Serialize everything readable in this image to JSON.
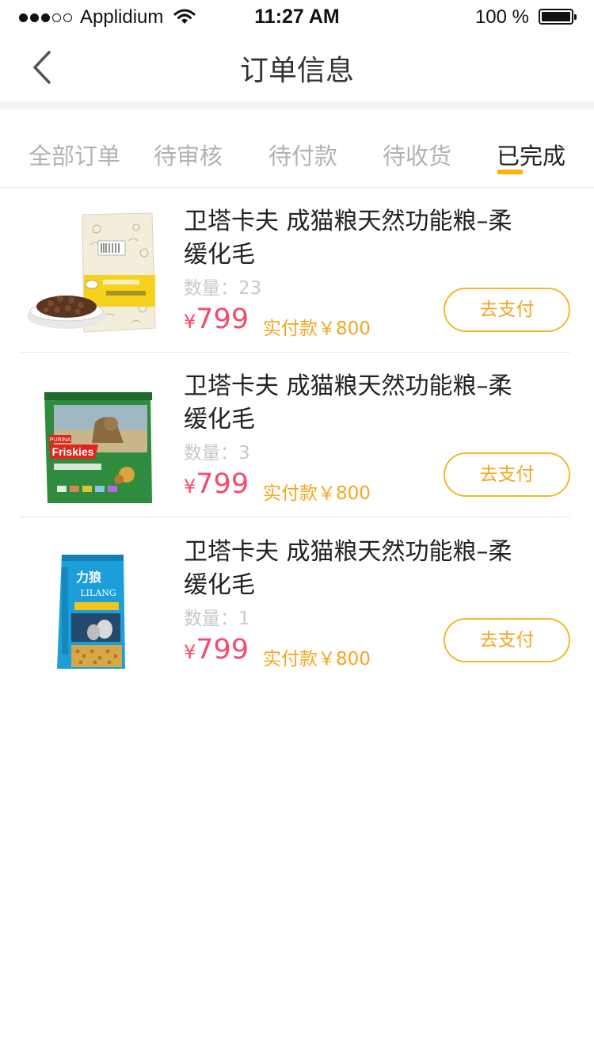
{
  "status_bar": {
    "carrier": "Applidium",
    "time": "11:27 AM",
    "battery": "100 %",
    "signal_bars_filled": 3,
    "signal_bars_total": 5
  },
  "nav": {
    "title": "订单信息",
    "back_icon": "chevron-left-icon"
  },
  "tabs": [
    {
      "label": "全部订单",
      "active": false
    },
    {
      "label": "待审核",
      "active": false
    },
    {
      "label": "待付款",
      "active": false
    },
    {
      "label": "待收货",
      "active": false
    },
    {
      "label": "已完成",
      "active": true
    }
  ],
  "colors": {
    "accent": "#ffb300",
    "price": "#f24c6e",
    "paid": "#f5a623"
  },
  "orders": [
    {
      "title": "卫塔卡夫 成猫粮天然功能粮–柔缓化毛",
      "qty_label": "数量：",
      "qty": "23",
      "currency": "¥",
      "price": "799",
      "paid_text": "实付款￥800",
      "button_label": "去支付",
      "image": "cream-cat-food-bag-with-kibble-bowl"
    },
    {
      "title": "卫塔卡夫 成猫粮天然功能粮–柔缓化毛",
      "qty_label": "数量：",
      "qty": "3",
      "currency": "¥",
      "price": "799",
      "paid_text": "实付款￥800",
      "button_label": "去支付",
      "image": "green-friskies-cat-food-bag"
    },
    {
      "title": "卫塔卡夫 成猫粮天然功能粮–柔缓化毛",
      "qty_label": "数量：",
      "qty": "1",
      "currency": "¥",
      "price": "799",
      "paid_text": "实付款￥800",
      "button_label": "去支付",
      "image": "blue-lilang-cat-food-bag"
    }
  ],
  "product_art": {
    "friskies_brand": "Friskies",
    "purina_brand": "PURINA",
    "lilang_brand_cn": "力狼",
    "lilang_brand_en": "LILANG"
  }
}
